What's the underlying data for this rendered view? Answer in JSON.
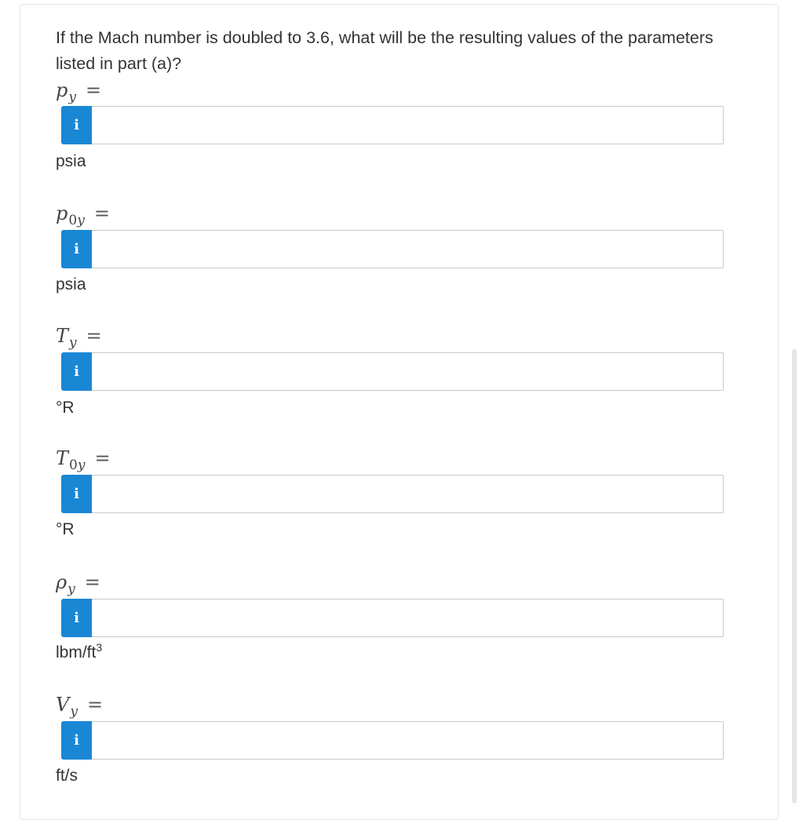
{
  "question": {
    "text": "If the Mach number is doubled to 3.6, what will be the resulting values of the parameters listed in part (a)?"
  },
  "info_icon": "i",
  "fields": [
    {
      "symbol": "p",
      "subscript": "y",
      "subscript_prefix": "",
      "equals": "=",
      "unit": "psia",
      "unit_sup": "",
      "value": ""
    },
    {
      "symbol": "p",
      "subscript": "y",
      "subscript_prefix": "0",
      "equals": "=",
      "unit": "psia",
      "unit_sup": "",
      "value": ""
    },
    {
      "symbol": "T",
      "subscript": "y",
      "subscript_prefix": "",
      "equals": "=",
      "unit": "°R",
      "unit_sup": "",
      "value": ""
    },
    {
      "symbol": "T",
      "subscript": "y",
      "subscript_prefix": "0",
      "equals": "=",
      "unit": "°R",
      "unit_sup": "",
      "value": ""
    },
    {
      "symbol": "ρ",
      "subscript": "y",
      "subscript_prefix": "",
      "equals": "=",
      "unit": "lbm/ft",
      "unit_sup": "3",
      "value": ""
    },
    {
      "symbol": "V",
      "subscript": "y",
      "subscript_prefix": "",
      "equals": "=",
      "unit": "ft/s",
      "unit_sup": "",
      "value": ""
    }
  ],
  "colors": {
    "info_button": "#1a87d5",
    "input_border": "#c9c9c9",
    "text": "#333333",
    "card_border": "#dfe3e8"
  }
}
